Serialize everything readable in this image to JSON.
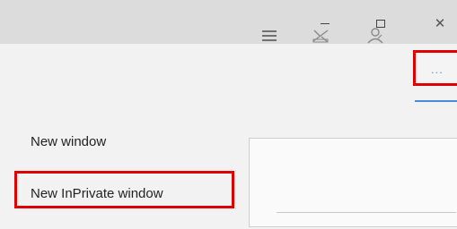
{
  "window_controls": {
    "minimize_icon": "minimize-icon",
    "maximize_icon": "maximize-icon",
    "close_label": "✕"
  },
  "toolbar": {
    "hub_icon": "hub-icon",
    "web_note_icon": "web-note-icon",
    "share_icon": "share-icon",
    "more_label": "...",
    "accent_color": "#4a8cd6"
  },
  "menu": {
    "items": [
      {
        "label": "New window"
      },
      {
        "label": "New InPrivate window"
      }
    ],
    "highlight_color": "#e00000"
  }
}
